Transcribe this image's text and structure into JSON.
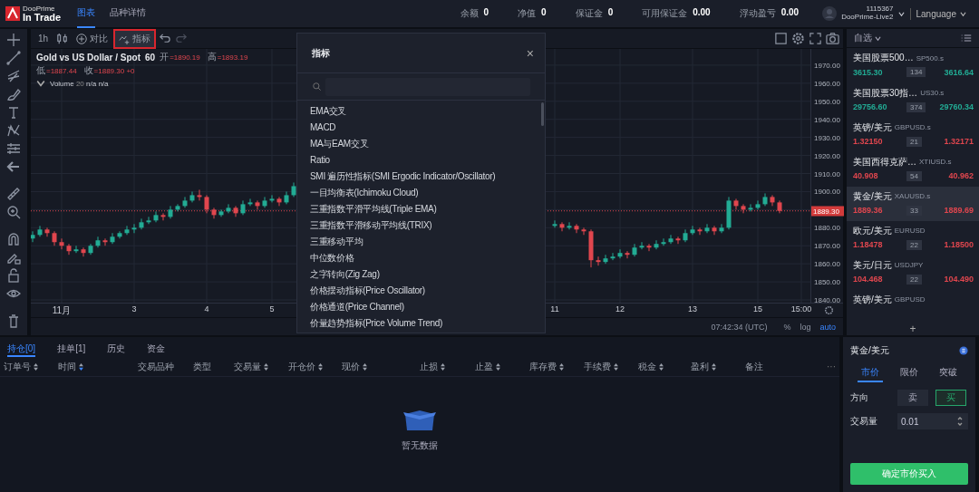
{
  "header": {
    "brand_small": "DooPrime",
    "brand": "In Trade",
    "nav": [
      {
        "label": "图表",
        "selected": true
      },
      {
        "label": "品种详情",
        "selected": false
      }
    ],
    "stats": [
      {
        "label": "余额",
        "value": "0"
      },
      {
        "label": "净值",
        "value": "0"
      },
      {
        "label": "保证金",
        "value": "0"
      },
      {
        "label": "可用保证金",
        "value": "0.00"
      },
      {
        "label": "浮动盈亏",
        "value": "0.00"
      }
    ],
    "account": {
      "id": "1115367",
      "server": "DooPrime-Live2"
    },
    "language": "Language"
  },
  "chart_toolbar": {
    "interval": "1h",
    "compare": "对比",
    "indicators": {
      "label": "指标",
      "highlighted": true
    }
  },
  "chart": {
    "symbol": "Gold vs US Dollar / Spot",
    "resolution": "60",
    "ohlc": [
      {
        "label": "开",
        "value": "=1890.19"
      },
      {
        "label": "高",
        "value": "=1893.19"
      },
      {
        "label": "低",
        "value": "=1887.44"
      },
      {
        "label": "收",
        "value": "=1889.30 +0"
      }
    ],
    "study": {
      "name": "Volume",
      "param": "20",
      "values": "n/a n/a"
    },
    "last_price": "1889.30",
    "clock": "07:42:34 (UTC)",
    "scale_options": [
      {
        "label": "%",
        "selected": false
      },
      {
        "label": "log",
        "selected": false
      },
      {
        "label": "auto",
        "selected": true
      }
    ],
    "chart_data": {
      "type": "candlestick",
      "ylim": [
        1838.5,
        1979
      ],
      "grid": true,
      "ref_lines": [
        {
          "axis": "y",
          "value": 1889.3,
          "color": "#e0464e"
        }
      ],
      "yticks": [
        {
          "value": 1970,
          "label": "1970.00"
        },
        {
          "value": 1960,
          "label": "1960.00"
        },
        {
          "value": 1950,
          "label": "1950.00"
        },
        {
          "value": 1940,
          "label": "1940.00"
        },
        {
          "value": 1930,
          "label": "1930.00"
        },
        {
          "value": 1920,
          "label": "1920.00"
        },
        {
          "value": 1910,
          "label": "1910.00"
        },
        {
          "value": 1900,
          "label": "1900.00"
        },
        {
          "value": 1880,
          "label": "1880.00"
        },
        {
          "value": 1870,
          "label": "1870.00"
        },
        {
          "value": 1860,
          "label": "1860.00"
        },
        {
          "value": 1850,
          "label": "1850.00"
        },
        {
          "value": 1840,
          "label": "1840.00"
        }
      ],
      "categories": [
        null,
        null,
        null,
        null,
        "11月",
        null,
        null,
        null,
        null,
        null,
        null,
        null,
        null,
        null,
        "3",
        null,
        null,
        null,
        null,
        null,
        null,
        null,
        null,
        null,
        "4",
        null,
        null,
        null,
        null,
        null,
        null,
        null,
        null,
        "5",
        null,
        null,
        null,
        null,
        null,
        null,
        null,
        null,
        null,
        null,
        null,
        null,
        null,
        null,
        null,
        null,
        null,
        null,
        null,
        null,
        null,
        null,
        null,
        null,
        null,
        null,
        null,
        null,
        null,
        null,
        null,
        null,
        null,
        null,
        null,
        null,
        null,
        null,
        "11",
        null,
        null,
        null,
        null,
        null,
        null,
        null,
        null,
        "12",
        null,
        null,
        null,
        null,
        null,
        null,
        null,
        null,
        null,
        "13",
        null,
        null,
        null,
        null,
        null,
        null,
        null,
        null,
        "15",
        null,
        null,
        null,
        null,
        null,
        "15:00",
        null
      ],
      "ohlc": [
        [
          1874,
          1878,
          1872,
          1876
        ],
        [
          1876,
          1881,
          1875,
          1879
        ],
        [
          1879,
          1880,
          1875,
          1877
        ],
        [
          1877,
          1878,
          1870,
          1872
        ],
        [
          1872,
          1874,
          1868,
          1870
        ],
        [
          1870,
          1871,
          1865,
          1867
        ],
        [
          1867,
          1870,
          1866,
          1868
        ],
        [
          1868,
          1869,
          1864,
          1866
        ],
        [
          1866,
          1871,
          1865,
          1870
        ],
        [
          1870,
          1875,
          1869,
          1873
        ],
        [
          1873,
          1874,
          1870,
          1872
        ],
        [
          1872,
          1877,
          1871,
          1875
        ],
        [
          1875,
          1878,
          1874,
          1877
        ],
        [
          1877,
          1881,
          1876,
          1879
        ],
        [
          1879,
          1882,
          1877,
          1880
        ],
        [
          1880,
          1885,
          1879,
          1883
        ],
        [
          1883,
          1886,
          1882,
          1884
        ],
        [
          1884,
          1889,
          1883,
          1887
        ],
        [
          1887,
          1888,
          1884,
          1886
        ],
        [
          1886,
          1892,
          1885,
          1890
        ],
        [
          1890,
          1893,
          1889,
          1892
        ],
        [
          1892,
          1897,
          1891,
          1895
        ],
        [
          1895,
          1900,
          1894,
          1898
        ],
        [
          1898,
          1901,
          1895,
          1897
        ],
        [
          1897,
          1898,
          1888,
          1890
        ],
        [
          1890,
          1891,
          1885,
          1887
        ],
        [
          1887,
          1890,
          1886,
          1889
        ],
        [
          1889,
          1893,
          1888,
          1891
        ],
        [
          1891,
          1892,
          1886,
          1888
        ],
        [
          1888,
          1895,
          1887,
          1893
        ],
        [
          1893,
          1896,
          1892,
          1894
        ],
        [
          1894,
          1895,
          1890,
          1892
        ],
        [
          1892,
          1897,
          1891,
          1895
        ],
        [
          1895,
          1898,
          1894,
          1896
        ],
        [
          1896,
          1897,
          1892,
          1894
        ],
        [
          1894,
          1900,
          1893,
          1898
        ],
        [
          1898,
          1905,
          1897,
          1903
        ],
        null,
        null,
        null,
        null,
        null,
        null,
        null,
        null,
        null,
        null,
        null,
        null,
        null,
        null,
        null,
        null,
        null,
        null,
        null,
        null,
        null,
        null,
        null,
        null,
        null,
        null,
        null,
        null,
        null,
        null,
        null,
        null,
        null,
        null,
        null,
        [
          1881,
          1884,
          1880,
          1882
        ],
        [
          1882,
          1883,
          1878,
          1880
        ],
        [
          1880,
          1883,
          1879,
          1881
        ],
        [
          1881,
          1882,
          1877,
          1879
        ],
        [
          1879,
          1880,
          1876,
          1878
        ],
        [
          1878,
          1879,
          1858,
          1862
        ],
        [
          1862,
          1864,
          1859,
          1861
        ],
        [
          1861,
          1865,
          1860,
          1863
        ],
        [
          1863,
          1866,
          1862,
          1864
        ],
        [
          1864,
          1868,
          1863,
          1866
        ],
        [
          1866,
          1867,
          1863,
          1865
        ],
        [
          1865,
          1871,
          1864,
          1869
        ],
        [
          1869,
          1872,
          1868,
          1870
        ],
        [
          1870,
          1871,
          1867,
          1869
        ],
        [
          1869,
          1873,
          1868,
          1871
        ],
        [
          1871,
          1874,
          1870,
          1872
        ],
        [
          1872,
          1876,
          1871,
          1874
        ],
        [
          1874,
          1875,
          1871,
          1873
        ],
        [
          1873,
          1879,
          1872,
          1877
        ],
        [
          1877,
          1881,
          1876,
          1879
        ],
        [
          1879,
          1880,
          1876,
          1878
        ],
        [
          1878,
          1882,
          1877,
          1880
        ],
        [
          1880,
          1881,
          1876,
          1878
        ],
        [
          1878,
          1882,
          1877,
          1880
        ],
        [
          1880,
          1897,
          1879,
          1895
        ],
        [
          1895,
          1896,
          1890,
          1892
        ],
        [
          1892,
          1893,
          1888,
          1890
        ],
        [
          1890,
          1893,
          1889,
          1891
        ],
        [
          1891,
          1895,
          1890,
          1893
        ],
        [
          1893,
          1899,
          1892,
          1897
        ],
        [
          1897,
          1898,
          1892,
          1894
        ],
        [
          1894,
          1895,
          1888,
          1889.3
        ],
        null,
        null,
        null,
        null
      ]
    }
  },
  "indicator_dialog": {
    "title": "指标",
    "close": "×",
    "items": [
      "EMA交叉",
      "MACD",
      "MA与EAM交叉",
      "Ratio",
      "SMI 遍历性指标(SMI Ergodic Indicator/Oscillator)",
      "一目均衡表(Ichimoku Cloud)",
      "三重指数平滑平均线(Triple EMA)",
      "三重指数平滑移动平均线(TRIX)",
      "三重移动平均",
      "中位数价格",
      "之字转向(Zig Zag)",
      "价格摆动指标(Price Oscillator)",
      "价格通道(Price Channel)",
      "价量趋势指标(Price Volume Trend)"
    ]
  },
  "watchlist": {
    "title": "自选",
    "items": [
      {
        "name": "美国股票500…",
        "code": "SP500.s",
        "bid": "3615.30",
        "spread": "134",
        "ask": "3616.64",
        "color": "#22ab94",
        "selected": false
      },
      {
        "name": "美国股票30指…",
        "code": "US30.s",
        "bid": "29756.60",
        "spread": "374",
        "ask": "29760.34",
        "color": "#22ab94",
        "selected": false
      },
      {
        "name": "英镑/美元",
        "code": "GBPUSD.s",
        "bid": "1.32150",
        "spread": "21",
        "ask": "1.32171",
        "color": "#e0464e",
        "selected": false
      },
      {
        "name": "美国西得克萨…",
        "code": "XTIUSD.s",
        "bid": "40.908",
        "spread": "54",
        "ask": "40.962",
        "color": "#e0464e",
        "selected": false
      },
      {
        "name": "黄金/美元",
        "code": "XAUUSD.s",
        "bid": "1889.36",
        "spread": "33",
        "ask": "1889.69",
        "color": "#e0464e",
        "selected": true
      },
      {
        "name": "欧元/美元",
        "code": "EURUSD",
        "bid": "1.18478",
        "spread": "22",
        "ask": "1.18500",
        "color": "#e0464e",
        "selected": false
      },
      {
        "name": "美元/日元",
        "code": "USDJPY",
        "bid": "104.468",
        "spread": "22",
        "ask": "104.490",
        "color": "#e0464e",
        "selected": false
      },
      {
        "name": "英镑/美元",
        "code": "GBPUSD"
      }
    ],
    "add": "+"
  },
  "orders": {
    "tabs": [
      {
        "label": "持仓[0]",
        "selected": true
      },
      {
        "label": "挂单[1]",
        "selected": false
      },
      {
        "label": "历史",
        "selected": false
      },
      {
        "label": "资金",
        "selected": false
      }
    ],
    "columns": [
      {
        "label": "订单号",
        "sortable": true,
        "sorted": false
      },
      {
        "label": "时间",
        "sortable": true,
        "sorted": true
      },
      {
        "label": "交易品种",
        "sortable": false,
        "sorted": false
      },
      {
        "label": "类型",
        "sortable": false,
        "sorted": false
      },
      {
        "label": "交易量",
        "sortable": true,
        "sorted": false
      },
      {
        "label": "开仓价",
        "sortable": true,
        "sorted": false
      },
      {
        "label": "现价",
        "sortable": true,
        "sorted": false
      },
      {
        "label": "止损",
        "sortable": true,
        "sorted": false
      },
      {
        "label": "止盈",
        "sortable": true,
        "sorted": false
      },
      {
        "label": "库存费",
        "sortable": true,
        "sorted": false
      },
      {
        "label": "手续费",
        "sortable": true,
        "sorted": false
      },
      {
        "label": "税金",
        "sortable": true,
        "sorted": false
      },
      {
        "label": "盈利",
        "sortable": true,
        "sorted": false
      },
      {
        "label": "备注",
        "sortable": false,
        "sorted": false
      }
    ],
    "more": "···",
    "empty_text": "暂无数据"
  },
  "order_panel": {
    "symbol": "黄金/美元",
    "tabs": [
      {
        "label": "市价",
        "selected": true
      },
      {
        "label": "限价",
        "selected": false
      },
      {
        "label": "突破",
        "selected": false
      }
    ],
    "direction_label": "方向",
    "directions": [
      {
        "label": "卖",
        "selected": false
      },
      {
        "label": "买",
        "selected": true
      }
    ],
    "volume_label": "交易量",
    "volume": "0.01",
    "submit": "确定市价买入"
  }
}
